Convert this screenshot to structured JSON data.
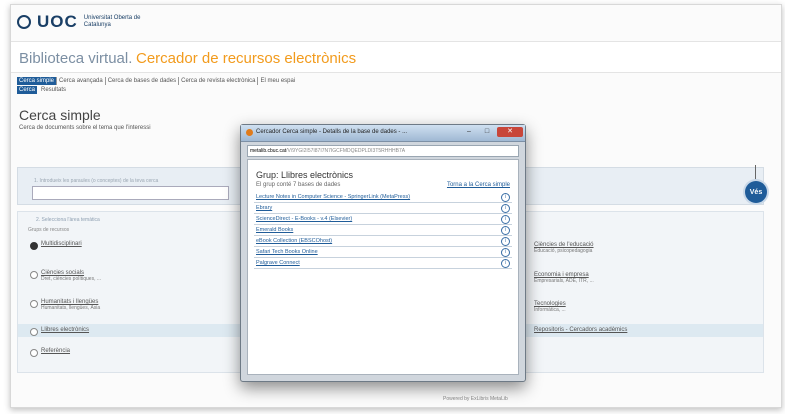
{
  "header": {
    "logo": "UOC",
    "logo_subtitle": "Universitat Oberta de Catalunya",
    "title": "Biblioteca virtual.",
    "title_accent": "Cercador de recursos electrònics"
  },
  "tabs": [
    {
      "label": "Cerca simple",
      "active": true
    },
    {
      "label": "Cerca avançada",
      "active": false
    },
    {
      "label": "Cerca de bases de dades",
      "active": false
    },
    {
      "label": "Cerca de revista electrònica",
      "active": false
    },
    {
      "label": "El meu espai",
      "active": false
    }
  ],
  "subtabs": [
    {
      "label": "Cerca",
      "active": true
    },
    {
      "label": "Resultats",
      "active": false
    }
  ],
  "section": {
    "title": "Cerca simple",
    "subtitle": "Cerca de documents sobre el tema que l'interessi"
  },
  "step1": {
    "label": "1. Introdueix les paraules (o conceptes) de la teva cerca",
    "go_label": "Vés"
  },
  "step2": {
    "label": "2. Selecciona l'àrea temàtica",
    "group_label": "Grups de recursos",
    "options_left": [
      {
        "label": "Multidisciplinari",
        "desc": "",
        "selected": true
      },
      {
        "label": "Ciències socials",
        "desc": "Dret, ciències polítiques, ...",
        "selected": false
      },
      {
        "label": "Humanitats i llengües",
        "desc": "Humanitats, llengües, Àsia",
        "selected": false
      },
      {
        "label": "Llibres electrònics",
        "desc": "",
        "selected": false
      },
      {
        "label": "Referència",
        "desc": "",
        "selected": false
      }
    ],
    "options_right": [
      {
        "label": "Ciències de l'educació",
        "desc": "Educació, psicopedagogia"
      },
      {
        "label": "Economia i empresa",
        "desc": "Empresarials, ADE, ITR, ..."
      },
      {
        "label": "Tecnologies",
        "desc": "Informàtica, ..."
      },
      {
        "label": "Repositoris - Cercadors acadèmics",
        "desc": ""
      }
    ]
  },
  "footer": "Powered by ExLibris MetaLib",
  "modal": {
    "window_title": "Cercador Cerca simple - Detalls de la base de dades - ...",
    "address_host": "metalib.cbuc.cat",
    "address_path": "/V/9YGI2I57I87I7N7IGCFMDQEDPLDI3T5RHHHB7A",
    "group_title": "Grup: Llibres electrònics",
    "group_count": "El grup conté 7 bases de dades",
    "back_link": "Torna a la Cerca simple",
    "databases": [
      "Lecture Notes in Computer Science - SpringerLink (MetaPress)",
      "Ebrary",
      "ScienceDirect - E-Books - v.4 (Elsevier)",
      "Emerald Books",
      "eBook Collection (EBSCOhost)",
      "Safari Tech Books Online",
      "Palgrave Connect"
    ],
    "info_glyph": "i"
  }
}
